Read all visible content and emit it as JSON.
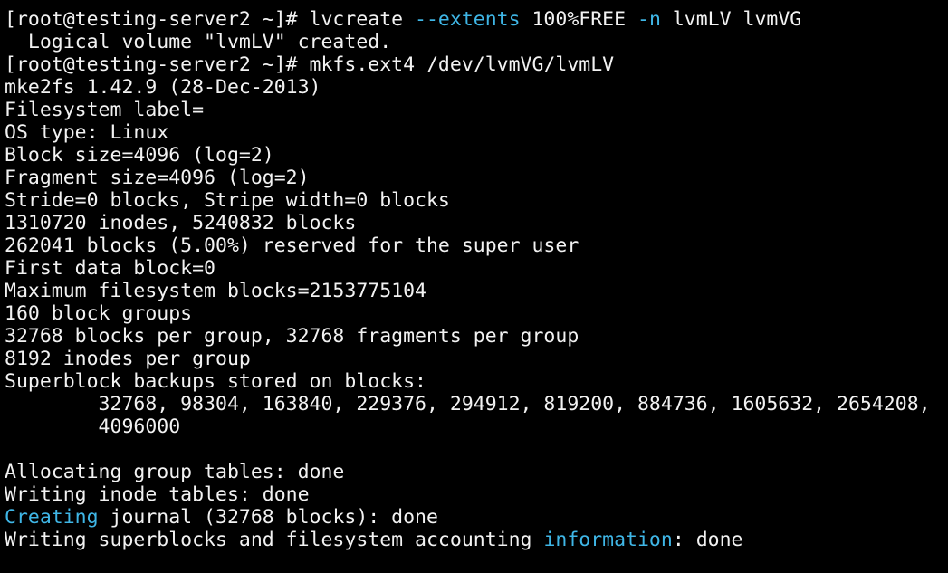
{
  "terminal": {
    "foreground": "#f2f2f2",
    "background": "#000000",
    "highlight_color": "#3fb6e6",
    "lines": [
      [
        {
          "text": "[root@testing-server2 ~]# lvcreate "
        },
        {
          "text": "--extents",
          "hl": true
        },
        {
          "text": " 100%FREE "
        },
        {
          "text": "-n",
          "hl": true
        },
        {
          "text": " lvmLV lvmVG"
        }
      ],
      [
        {
          "text": "  Logical volume \"lvmLV\" created."
        }
      ],
      [
        {
          "text": "[root@testing-server2 ~]# mkfs.ext4 /dev/lvmVG/lvmLV"
        }
      ],
      [
        {
          "text": "mke2fs 1.42.9 (28-Dec-2013)"
        }
      ],
      [
        {
          "text": "Filesystem label="
        }
      ],
      [
        {
          "text": "OS type: Linux"
        }
      ],
      [
        {
          "text": "Block size=4096 (log=2)"
        }
      ],
      [
        {
          "text": "Fragment size=4096 (log=2)"
        }
      ],
      [
        {
          "text": "Stride=0 blocks, Stripe width=0 blocks"
        }
      ],
      [
        {
          "text": "1310720 inodes, 5240832 blocks"
        }
      ],
      [
        {
          "text": "262041 blocks (5.00%) reserved for the super user"
        }
      ],
      [
        {
          "text": "First data block=0"
        }
      ],
      [
        {
          "text": "Maximum filesystem blocks=2153775104"
        }
      ],
      [
        {
          "text": "160 block groups"
        }
      ],
      [
        {
          "text": "32768 blocks per group, 32768 fragments per group"
        }
      ],
      [
        {
          "text": "8192 inodes per group"
        }
      ],
      [
        {
          "text": "Superblock backups stored on blocks:"
        }
      ],
      [
        {
          "text": "        32768, 98304, 163840, 229376, 294912, 819200, 884736, 1605632, 2654208,"
        }
      ],
      [
        {
          "text": "        4096000"
        }
      ],
      [
        {
          "text": ""
        }
      ],
      [
        {
          "text": "Allocating group tables: done"
        }
      ],
      [
        {
          "text": "Writing inode tables: done"
        }
      ],
      [
        {
          "text": "Creating",
          "hl": true
        },
        {
          "text": " journal (32768 blocks): done"
        }
      ],
      [
        {
          "text": "Writing superblocks and filesystem accounting "
        },
        {
          "text": "information",
          "hl": true
        },
        {
          "text": ": done"
        }
      ]
    ]
  }
}
